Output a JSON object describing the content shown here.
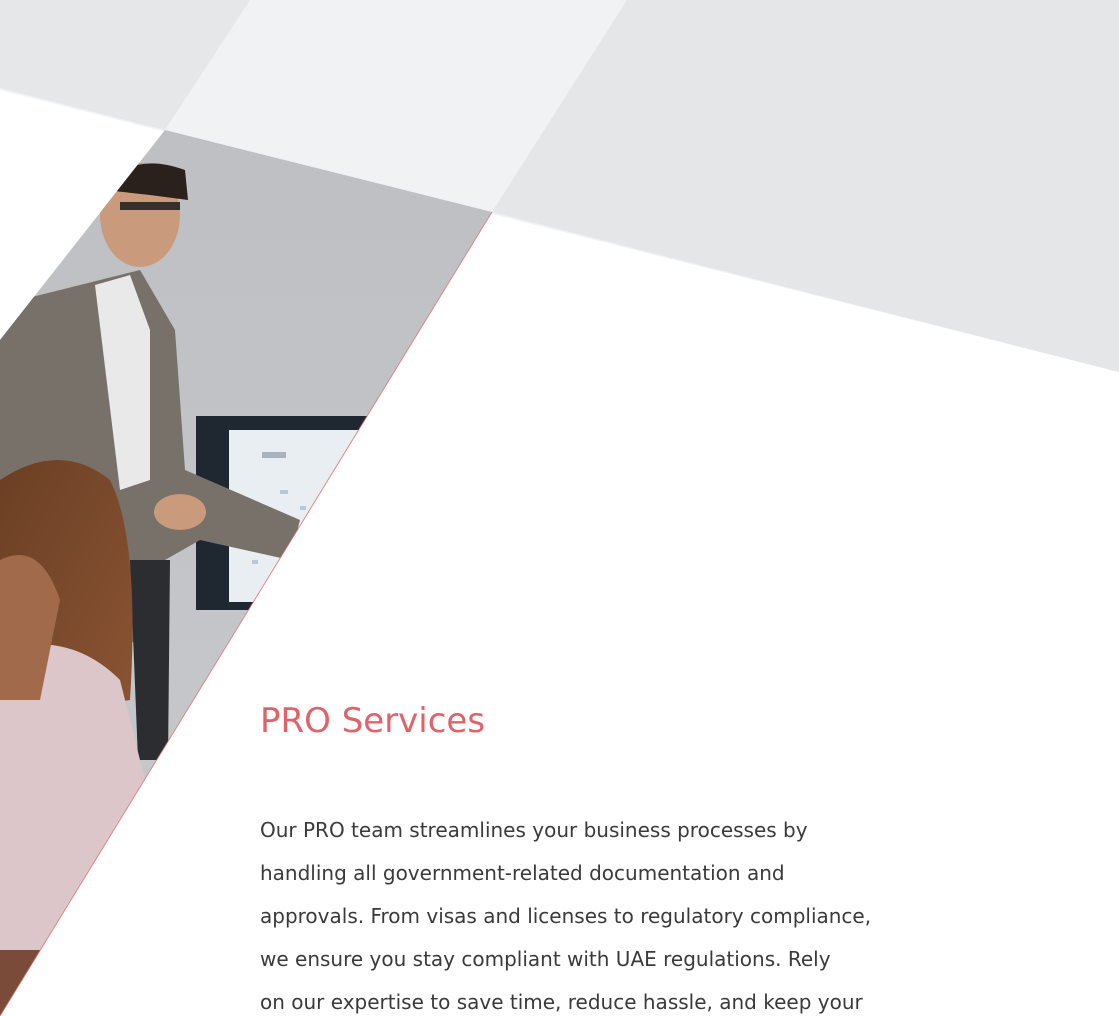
{
  "section": {
    "heading": "PRO Services",
    "body_lines": [
      "Our PRO team streamlines your business processes by",
      "handling all government-related documentation and",
      "approvals. From visas and licenses to regulatory compliance,",
      "we ensure you stay compliant with UAE regulations. Rely",
      "on our expertise to save time, reduce hassle, and keep your"
    ]
  },
  "colors": {
    "accent": "#e0626a",
    "body_text": "#3a3a3a",
    "shape_light": "#f1f2f4",
    "shape_mid": "#e5e6e8"
  },
  "photo": {
    "subject": "presenter pointing at a screen with a seated colleague in the foreground"
  }
}
